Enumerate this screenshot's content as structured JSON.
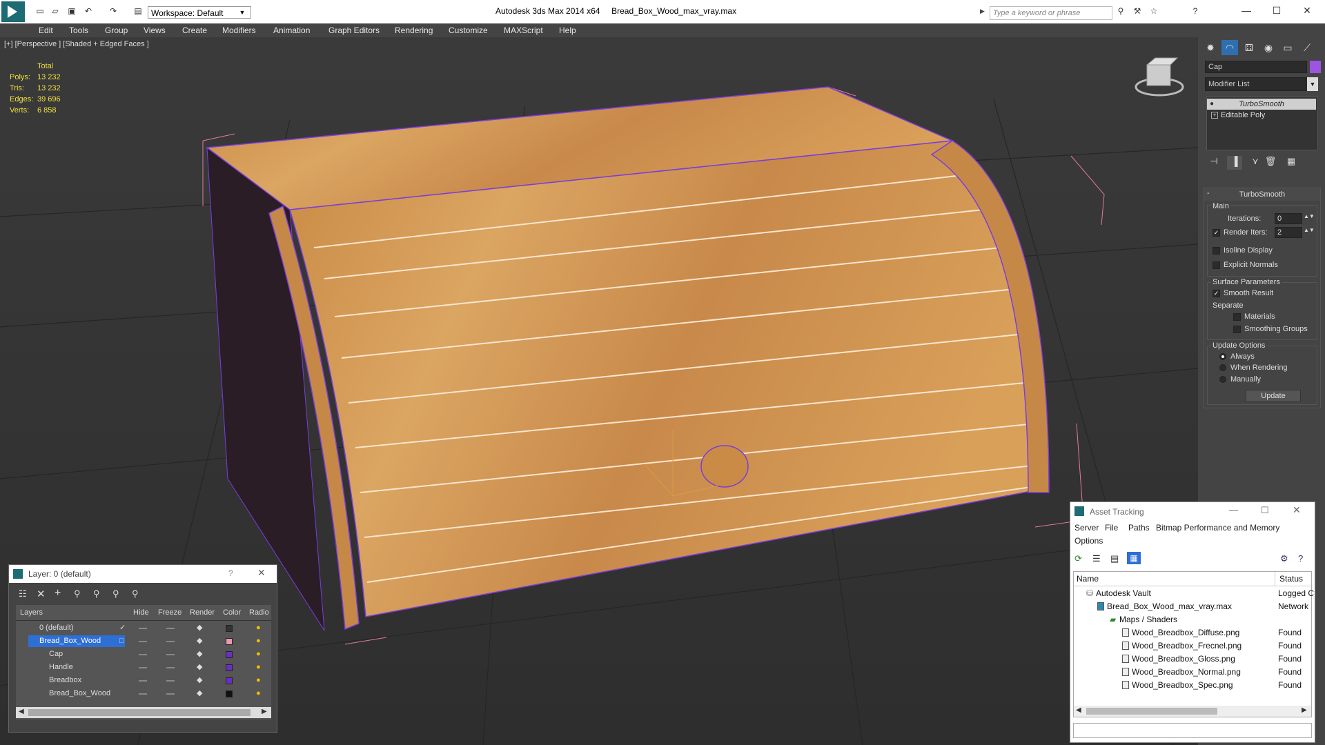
{
  "titlebar": {
    "workspace": "Workspace: Default",
    "app_title": "Autodesk 3ds Max  2014 x64",
    "file_name": "Bread_Box_Wood_max_vray.max",
    "search_placeholder": "Type a keyword or phrase"
  },
  "menu": [
    "Edit",
    "Tools",
    "Group",
    "Views",
    "Create",
    "Modifiers",
    "Animation",
    "Graph Editors",
    "Rendering",
    "Customize",
    "MAXScript",
    "Help"
  ],
  "viewport": {
    "label": "[+] [Perspective ] [Shaded + Edged Faces ]",
    "stats": {
      "header": "Total",
      "rows": [
        {
          "k": "Polys:",
          "v": "13 232"
        },
        {
          "k": "Tris:",
          "v": "13 232"
        },
        {
          "k": "Edges:",
          "v": "39 696"
        },
        {
          "k": "Verts:",
          "v": "6 858"
        }
      ]
    }
  },
  "command_panel": {
    "object_name": "Cap",
    "object_color": "#9b55e0",
    "modifier_list": "Modifier List",
    "stack": [
      "TurboSmooth",
      "Editable Poly"
    ],
    "turbosmooth": {
      "title": "TurboSmooth",
      "main": "Main",
      "iterations_label": "Iterations:",
      "iterations": "0",
      "render_iters_label": "Render Iters:",
      "render_iters": "2",
      "isoline": "Isoline Display",
      "explicit": "Explicit Normals",
      "surface": "Surface Parameters",
      "smooth_result": "Smooth Result",
      "separate": "Separate",
      "materials": "Materials",
      "smoothing_groups": "Smoothing Groups",
      "update_options": "Update Options",
      "always": "Always",
      "when_rendering": "When Rendering",
      "manually": "Manually",
      "update": "Update"
    }
  },
  "layer_window": {
    "title": "Layer: 0 (default)",
    "help": "?",
    "columns": [
      "Layers",
      "Hide",
      "Freeze",
      "Render",
      "Color",
      "Radio"
    ],
    "rows": [
      {
        "name": "0 (default)",
        "color": "#333333"
      },
      {
        "name": "Bread_Box_Wood",
        "color": "#e89ab0"
      },
      {
        "name": "Cap",
        "color": "#6a2fc0"
      },
      {
        "name": "Handle",
        "color": "#6a2fc0"
      },
      {
        "name": "Breadbox",
        "color": "#6a2fc0"
      },
      {
        "name": "Bread_Box_Wood",
        "color": "#111111"
      }
    ]
  },
  "asset_window": {
    "title": "Asset Tracking",
    "menu": [
      "Server",
      "File",
      "Paths",
      "Bitmap Performance and Memory",
      "Options"
    ],
    "columns": [
      "Name",
      "Status"
    ],
    "rows": [
      {
        "name": "Autodesk Vault",
        "status": "Logged C"
      },
      {
        "name": "Bread_Box_Wood_max_vray.max",
        "status": "Network"
      },
      {
        "name": "Maps / Shaders",
        "status": ""
      },
      {
        "name": "Wood_Breadbox_Diffuse.png",
        "status": "Found"
      },
      {
        "name": "Wood_Breadbox_Frecnel.png",
        "status": "Found"
      },
      {
        "name": "Wood_Breadbox_Gloss.png",
        "status": "Found"
      },
      {
        "name": "Wood_Breadbox_Normal.png",
        "status": "Found"
      },
      {
        "name": "Wood_Breadbox_Spec.png",
        "status": "Found"
      }
    ]
  }
}
